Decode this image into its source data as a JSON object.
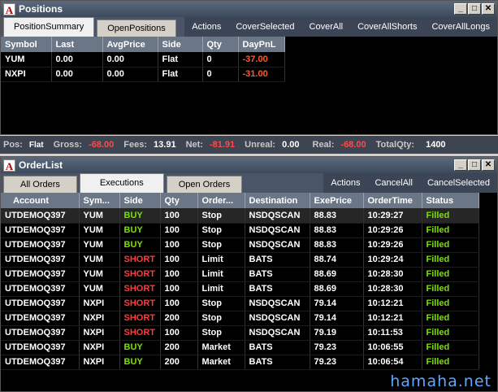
{
  "positions_window": {
    "title": "Positions",
    "tabs": [
      "PositionSummary",
      "OpenPositions"
    ],
    "actions": [
      "Actions",
      "CoverSelected",
      "CoverAll",
      "CoverAllShorts",
      "CoverAllLongs"
    ],
    "columns": [
      "Symbol",
      "Last",
      "AvgPrice",
      "Side",
      "Qty",
      "DayPnL"
    ],
    "rows": [
      {
        "symbol": "YUM",
        "last": "0.00",
        "avgprice": "0.00",
        "side": "Flat",
        "qty": "0",
        "daypnl": "-37.00"
      },
      {
        "symbol": "NXPI",
        "last": "0.00",
        "avgprice": "0.00",
        "side": "Flat",
        "qty": "0",
        "daypnl": "-31.00"
      }
    ]
  },
  "summary_bar": {
    "pos_label": "Pos:",
    "pos_value": "Flat",
    "gross_label": "Gross:",
    "gross_value": "-68.00",
    "fees_label": "Fees:",
    "fees_value": "13.91",
    "net_label": "Net:",
    "net_value": "-81.91",
    "unreal_label": "Unreal:",
    "unreal_value": "0.00",
    "real_label": "Real:",
    "real_value": "-68.00",
    "totalqty_label": "TotalQty:",
    "totalqty_value": "1400"
  },
  "orderlist_window": {
    "title": "OrderList",
    "tabs": [
      "All Orders",
      "Executions",
      "Open Orders"
    ],
    "actions": [
      "Actions",
      "CancelAll",
      "CancelSelected"
    ],
    "columns": [
      "Account",
      "Sym...",
      "Side",
      "Qty",
      "Order...",
      "Destination",
      "ExePrice",
      "OrderTime",
      "Status"
    ],
    "rows": [
      {
        "account": "UTDEMOQ397",
        "sym": "YUM",
        "side": "BUY",
        "qty": "100",
        "order": "Stop",
        "destination": "NSDQSCAN",
        "exeprice": "88.83",
        "ordertime": "10:29:27",
        "status": "Filled"
      },
      {
        "account": "UTDEMOQ397",
        "sym": "YUM",
        "side": "BUY",
        "qty": "100",
        "order": "Stop",
        "destination": "NSDQSCAN",
        "exeprice": "88.83",
        "ordertime": "10:29:26",
        "status": "Filled"
      },
      {
        "account": "UTDEMOQ397",
        "sym": "YUM",
        "side": "BUY",
        "qty": "100",
        "order": "Stop",
        "destination": "NSDQSCAN",
        "exeprice": "88.83",
        "ordertime": "10:29:26",
        "status": "Filled"
      },
      {
        "account": "UTDEMOQ397",
        "sym": "YUM",
        "side": "SHORT",
        "qty": "100",
        "order": "Limit",
        "destination": "BATS",
        "exeprice": "88.74",
        "ordertime": "10:29:24",
        "status": "Filled"
      },
      {
        "account": "UTDEMOQ397",
        "sym": "YUM",
        "side": "SHORT",
        "qty": "100",
        "order": "Limit",
        "destination": "BATS",
        "exeprice": "88.69",
        "ordertime": "10:28:30",
        "status": "Filled"
      },
      {
        "account": "UTDEMOQ397",
        "sym": "YUM",
        "side": "SHORT",
        "qty": "100",
        "order": "Limit",
        "destination": "BATS",
        "exeprice": "88.69",
        "ordertime": "10:28:30",
        "status": "Filled"
      },
      {
        "account": "UTDEMOQ397",
        "sym": "NXPI",
        "side": "SHORT",
        "qty": "100",
        "order": "Stop",
        "destination": "NSDQSCAN",
        "exeprice": "79.14",
        "ordertime": "10:12:21",
        "status": "Filled"
      },
      {
        "account": "UTDEMOQ397",
        "sym": "NXPI",
        "side": "SHORT",
        "qty": "200",
        "order": "Stop",
        "destination": "NSDQSCAN",
        "exeprice": "79.14",
        "ordertime": "10:12:21",
        "status": "Filled"
      },
      {
        "account": "UTDEMOQ397",
        "sym": "NXPI",
        "side": "SHORT",
        "qty": "100",
        "order": "Stop",
        "destination": "NSDQSCAN",
        "exeprice": "79.19",
        "ordertime": "10:11:53",
        "status": "Filled"
      },
      {
        "account": "UTDEMOQ397",
        "sym": "NXPI",
        "side": "BUY",
        "qty": "200",
        "order": "Market",
        "destination": "BATS",
        "exeprice": "79.23",
        "ordertime": "10:06:55",
        "status": "Filled"
      },
      {
        "account": "UTDEMOQ397",
        "sym": "NXPI",
        "side": "BUY",
        "qty": "200",
        "order": "Market",
        "destination": "BATS",
        "exeprice": "79.23",
        "ordertime": "10:06:54",
        "status": "Filled"
      }
    ]
  },
  "watermark": "hamaha.net",
  "colors": {
    "buy": "#7ce000",
    "short": "#ff3b3b",
    "filled": "#7ce000",
    "negative": "#ff5a28"
  }
}
